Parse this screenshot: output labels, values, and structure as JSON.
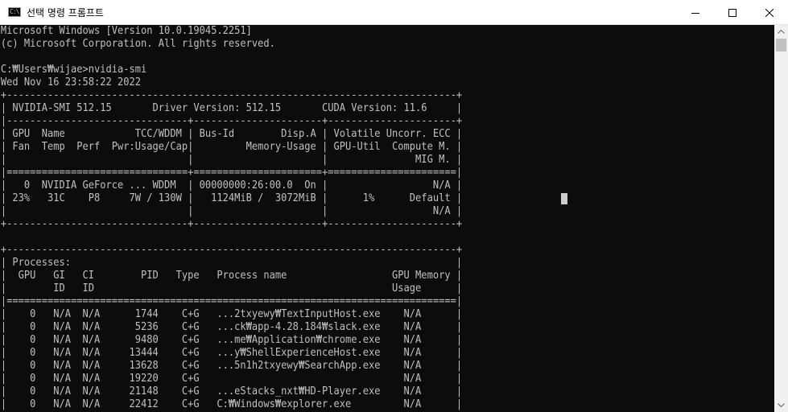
{
  "window": {
    "title": "선택 명령 프롬프트",
    "icon_label": "C:\\"
  },
  "icons": {
    "app": "command-prompt-icon",
    "minimize": "minimize-icon",
    "maximize": "maximize-icon",
    "close": "close-icon",
    "scroll_up": "arrow-up-icon",
    "scroll_down": "arrow-down-icon"
  },
  "console": {
    "background": "#0c0c0c",
    "foreground": "#c0c0c0",
    "lines": [
      "Microsoft Windows [Version 10.0.19045.2251]",
      "(c) Microsoft Corporation. All rights reserved.",
      "",
      "C:₩Users₩wijae>nvidia-smi",
      "Wed Nov 16 23:58:22 2022",
      "+-----------------------------------------------------------------------------+",
      "| NVIDIA-SMI 512.15       Driver Version: 512.15       CUDA Version: 11.6     |",
      "|-------------------------------+----------------------+----------------------+",
      "| GPU  Name            TCC/WDDM | Bus-Id        Disp.A | Volatile Uncorr. ECC |",
      "| Fan  Temp  Perf  Pwr:Usage/Cap|         Memory-Usage | GPU-Util  Compute M. |",
      "|                               |                      |               MIG M. |",
      "|===============================+======================+======================|",
      "|   0  NVIDIA GeForce ... WDDM  | 00000000:26:00.0  On |                  N/A |",
      "| 23%   31C    P8     7W / 130W |   1124MiB /  3072MiB |      1%      Default |",
      "|                               |                      |                  N/A |",
      "+-------------------------------+----------------------+----------------------+",
      "",
      "+-----------------------------------------------------------------------------+",
      "| Processes:                                                                  |",
      "|  GPU   GI   CI        PID   Type   Process name                  GPU Memory |",
      "|        ID   ID                                                   Usage      |",
      "|=============================================================================|",
      "|    0   N/A  N/A      1744    C+G   ...2txyewy₩TextInputHost.exe    N/A      |",
      "|    0   N/A  N/A      5236    C+G   ...ck₩app-4.28.184₩slack.exe    N/A      |",
      "|    0   N/A  N/A      9480    C+G   ...me₩Application₩chrome.exe    N/A      |",
      "|    0   N/A  N/A     13444    C+G   ...y₩ShellExperienceHost.exe    N/A      |",
      "|    0   N/A  N/A     13628    C+G   ...5n1h2txyewy₩SearchApp.exe    N/A      |",
      "|    0   N/A  N/A     19220    C+G                                   N/A      |",
      "|    0   N/A  N/A     21148    C+G   ...eStacks_nxt₩HD-Player.exe    N/A      |",
      "|    0   N/A  N/A     22412    C+G   C:₩Windows₩explorer.exe         N/A      |"
    ]
  },
  "scrollbar": {
    "position_fraction": 0.0
  }
}
